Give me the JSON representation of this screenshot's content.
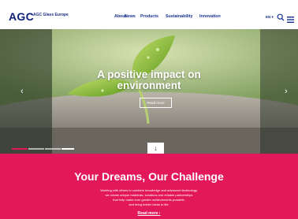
{
  "header": {
    "logo": "AGC",
    "brand": "AGC Glass Europe",
    "nav": [
      "About",
      "News",
      "Products",
      "Sustainability",
      "Innovation"
    ],
    "language": "EN ▾"
  },
  "hero": {
    "title_line1": "A positive impact on",
    "title_line2": "environment",
    "button": "Read more",
    "down_arrow": "↓",
    "prev_arrow": "‹",
    "next_arrow": "›",
    "slides_total": 4,
    "active_slide": 1
  },
  "section": {
    "title": "Your Dreams, Our Challenge",
    "text_lines": [
      "Working with others to combine knowledge and advanced technology,",
      "we create unique materials, solutions and reliable partnerships",
      "that help make ever greater achievements possible,",
      "and bring bolder ideas to life."
    ],
    "link": "Read more ›"
  },
  "colors": {
    "brand_blue": "#0a1f78",
    "accent_red": "#e2185a"
  },
  "icons": [
    "search-icon",
    "menu-icon",
    "chevron-left-icon",
    "chevron-right-icon",
    "arrow-down-icon"
  ]
}
